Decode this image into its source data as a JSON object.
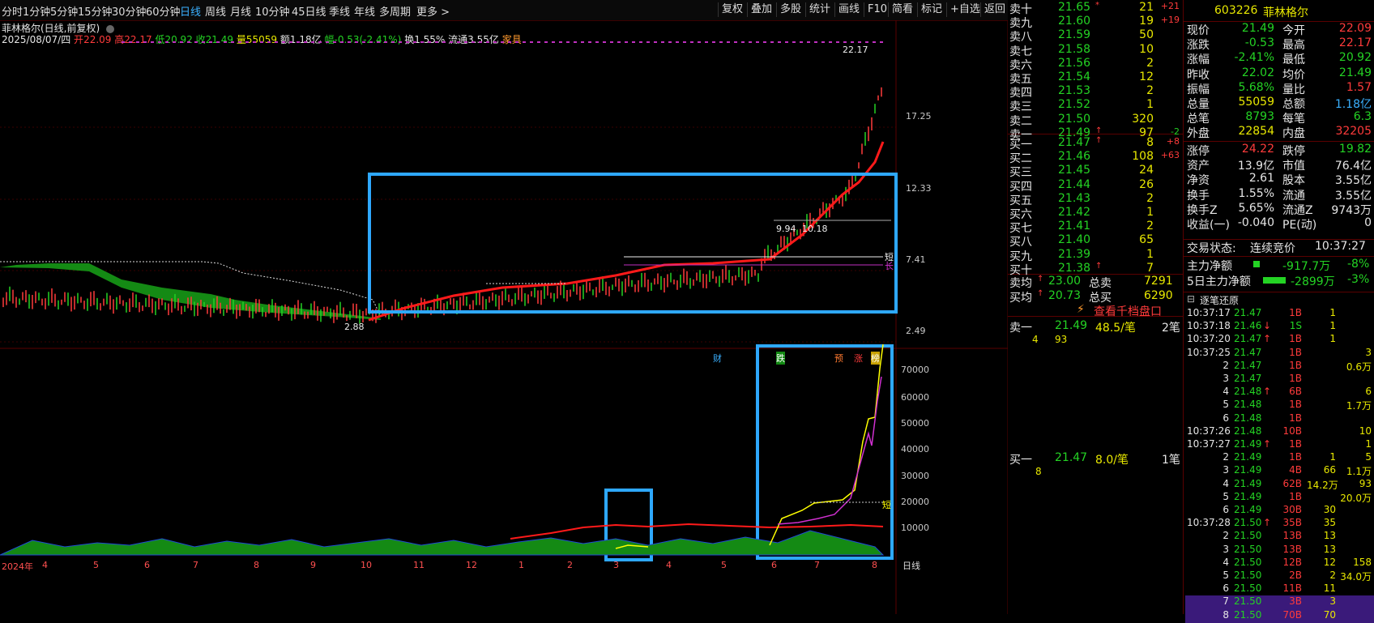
{
  "toolbar": {
    "periods": [
      "分时",
      "1分钟",
      "5分钟",
      "15分钟",
      "30分钟",
      "60分钟",
      "日线",
      "周线",
      "月线",
      "10分钟",
      "45日线",
      "季线",
      "年线",
      "多周期",
      "更多 >"
    ],
    "active_period": "日线",
    "buttons": [
      "复权",
      "叠加",
      "多股",
      "统计",
      "画线",
      "F10",
      "简看",
      "标记",
      "+自选",
      "返回"
    ]
  },
  "chart_header": {
    "title": "菲林格尔(日线,前复权)",
    "date": "2025/08/07/四",
    "open_label": "开",
    "open": "22.09",
    "high_label": "高",
    "high": "22.17",
    "low_label": "低",
    "low": "20.92",
    "close_label": "收",
    "close": "21.49",
    "vol_label": "量",
    "vol": "55059",
    "amount_label": "额",
    "amount": "1.18亿",
    "change_label": "幅",
    "change": "-0.53(-2.41%)",
    "turnover_label": "换",
    "turnover": "1.55%",
    "float_label": "流通",
    "float": "3.55亿",
    "extra": "家具"
  },
  "price_axis": [
    "17.25",
    "12.33",
    "7.41",
    "2.49"
  ],
  "price_annotations": {
    "high_mark": "22.17",
    "low_mark": "2.88",
    "level_1": "9.94",
    "level_2": "10.18",
    "short_tag": "短",
    "long_tag": "长"
  },
  "event_tags": [
    "财",
    "跌",
    "预",
    "涨",
    "榜"
  ],
  "vol_axis": [
    "70000",
    "60000",
    "50000",
    "40000",
    "30000",
    "20000",
    "10000"
  ],
  "vol_short_tag": "短",
  "x_axis": [
    "2024年",
    "4",
    "5",
    "6",
    "7",
    "8",
    "9",
    "10",
    "11",
    "12",
    "1",
    "2",
    "3",
    "4",
    "5",
    "6",
    "7",
    "8"
  ],
  "x_axis_unit": "日线",
  "order_book": {
    "asks": [
      {
        "label": "卖十",
        "price": "21.65",
        "vol": "21",
        "chg": "+21",
        "arrow": "*"
      },
      {
        "label": "卖九",
        "price": "21.60",
        "vol": "19",
        "chg": "+19",
        "arrow": ""
      },
      {
        "label": "卖八",
        "price": "21.59",
        "vol": "50",
        "chg": "",
        "arrow": ""
      },
      {
        "label": "卖七",
        "price": "21.58",
        "vol": "10",
        "chg": "",
        "arrow": ""
      },
      {
        "label": "卖六",
        "price": "21.56",
        "vol": "2",
        "chg": "",
        "arrow": ""
      },
      {
        "label": "卖五",
        "price": "21.54",
        "vol": "12",
        "chg": "",
        "arrow": ""
      },
      {
        "label": "卖四",
        "price": "21.53",
        "vol": "2",
        "chg": "",
        "arrow": ""
      },
      {
        "label": "卖三",
        "price": "21.52",
        "vol": "1",
        "chg": "",
        "arrow": ""
      },
      {
        "label": "卖二",
        "price": "21.50",
        "vol": "320",
        "chg": "",
        "arrow": ""
      },
      {
        "label": "卖一",
        "price": "21.49",
        "vol": "97",
        "chg": "-2",
        "arrow": "↑"
      }
    ],
    "bids": [
      {
        "label": "买一",
        "price": "21.47",
        "vol": "8",
        "chg": "+8",
        "arrow": "↑"
      },
      {
        "label": "买二",
        "price": "21.46",
        "vol": "108",
        "chg": "+63",
        "arrow": ""
      },
      {
        "label": "买三",
        "price": "21.45",
        "vol": "24",
        "chg": "",
        "arrow": ""
      },
      {
        "label": "买四",
        "price": "21.44",
        "vol": "26",
        "chg": "",
        "arrow": ""
      },
      {
        "label": "买五",
        "price": "21.43",
        "vol": "2",
        "chg": "",
        "arrow": ""
      },
      {
        "label": "买六",
        "price": "21.42",
        "vol": "1",
        "chg": "",
        "arrow": ""
      },
      {
        "label": "买七",
        "price": "21.41",
        "vol": "2",
        "chg": "",
        "arrow": ""
      },
      {
        "label": "买八",
        "price": "21.40",
        "vol": "65",
        "chg": "",
        "arrow": ""
      },
      {
        "label": "买九",
        "price": "21.39",
        "vol": "1",
        "chg": "",
        "arrow": ""
      },
      {
        "label": "买十",
        "price": "21.38",
        "vol": "7",
        "chg": "",
        "arrow": "↑"
      }
    ],
    "avg_sell_label": "卖均",
    "avg_sell": "23.00",
    "total_sell_label": "总卖",
    "total_sell": "7291",
    "avg_buy_label": "买均",
    "avg_buy": "20.73",
    "total_buy_label": "总买",
    "total_buy": "6290",
    "depth_link": "查看千档盘口",
    "queue_sell": {
      "label": "卖一",
      "price": "21.49",
      "avg": "48.5/笔",
      "count": "2笔",
      "orders": [
        "4",
        "93"
      ]
    },
    "queue_buy": {
      "label": "买一",
      "price": "21.47",
      "avg": "8.0/笔",
      "count": "1笔",
      "orders": [
        "8"
      ]
    }
  },
  "quote": {
    "code": "603226",
    "name": "菲林格尔",
    "rows": [
      [
        "现价",
        "21.49",
        "今开",
        "22.09"
      ],
      [
        "涨跌",
        "-0.53",
        "最高",
        "22.17"
      ],
      [
        "涨幅",
        "-2.41%",
        "最低",
        "20.92"
      ],
      [
        "昨收",
        "22.02",
        "均价",
        "21.49"
      ],
      [
        "振幅",
        "5.68%",
        "量比",
        "1.57"
      ],
      [
        "总量",
        "55059",
        "总额",
        "1.18亿"
      ],
      [
        "总笔",
        "8793",
        "每笔",
        "6.3"
      ],
      [
        "外盘",
        "22854",
        "内盘",
        "32205"
      ]
    ],
    "rows2": [
      [
        "涨停",
        "24.22",
        "跌停",
        "19.82"
      ],
      [
        "资产",
        "13.9亿",
        "市值",
        "76.4亿"
      ],
      [
        "净资",
        "2.61",
        "股本",
        "3.55亿"
      ],
      [
        "换手",
        "1.55%",
        "流通",
        "3.55亿"
      ],
      [
        "换手Z",
        "5.65%",
        "流通Z",
        "9743万"
      ],
      [
        "收益(一)",
        "-0.040",
        "PE(动)",
        "0"
      ]
    ],
    "trade_status_label": "交易状态:",
    "trade_status": "连续竞价",
    "trade_time": "10:37:27",
    "main_net_label": "主力净额",
    "main_net": "-917.7万",
    "main_net_pct": "-8%",
    "main_net5_label": "5日主力净额",
    "main_net5": "-2899万",
    "main_net5_pct": "-3%"
  },
  "ticks": {
    "title": "逐笔还原",
    "rows": [
      [
        "10:37:17",
        "21.47",
        "",
        "1B",
        "1",
        ""
      ],
      [
        "10:37:18",
        "21.46",
        "↓",
        "1S",
        "1",
        ""
      ],
      [
        "10:37:20",
        "21.47",
        "↑",
        "1B",
        "1",
        ""
      ],
      [
        "10:37:25",
        "21.47",
        "",
        "1B",
        "",
        "3"
      ],
      [
        "2",
        "21.47",
        "",
        "1B",
        "",
        "0.6万"
      ],
      [
        "3",
        "21.47",
        "",
        "1B",
        "",
        ""
      ],
      [
        "4",
        "21.48",
        "↑",
        "6B",
        "",
        "6"
      ],
      [
        "5",
        "21.48",
        "",
        "1B",
        "",
        "1.7万"
      ],
      [
        "6",
        "21.48",
        "",
        "1B",
        "",
        ""
      ],
      [
        "10:37:26",
        "21.48",
        "",
        "10B",
        "",
        "10"
      ],
      [
        "10:37:27",
        "21.49",
        "↑",
        "1B",
        "",
        "1"
      ],
      [
        "2",
        "21.49",
        "",
        "1B",
        "1",
        "5"
      ],
      [
        "3",
        "21.49",
        "",
        "4B",
        "66",
        "1.1万"
      ],
      [
        "4",
        "21.49",
        "",
        "62B",
        "14.2万",
        "93"
      ],
      [
        "5",
        "21.49",
        "",
        "1B",
        "",
        "20.0万"
      ],
      [
        "6",
        "21.49",
        "",
        "30B",
        "30",
        ""
      ],
      [
        "10:37:28",
        "21.50",
        "↑",
        "35B",
        "35",
        ""
      ],
      [
        "2",
        "21.50",
        "",
        "13B",
        "13",
        ""
      ],
      [
        "3",
        "21.50",
        "",
        "13B",
        "13",
        ""
      ],
      [
        "4",
        "21.50",
        "",
        "12B",
        "12",
        "158"
      ],
      [
        "5",
        "21.50",
        "",
        "2B",
        "2",
        "34.0万"
      ],
      [
        "6",
        "21.50",
        "",
        "11B",
        "11",
        ""
      ],
      [
        "7",
        "21.50",
        "",
        "3B",
        "3",
        ""
      ],
      [
        "8",
        "21.50",
        "",
        "70B",
        "70",
        ""
      ]
    ]
  },
  "colors": {
    "up": "#ff3b3b",
    "down": "#24d324",
    "highlight": "#2ea8ff",
    "ma": "#ff0000",
    "cloud": "#1a8a1a"
  }
}
